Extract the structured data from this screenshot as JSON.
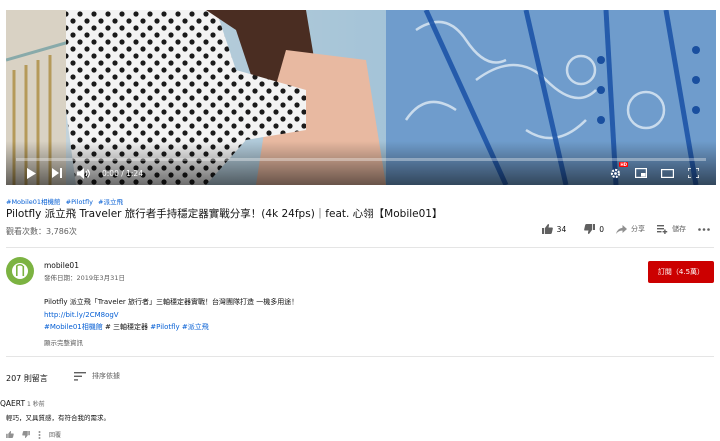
{
  "player": {
    "time": "0:00 / 1:24",
    "progress": 0.0,
    "icons": [
      "play-icon",
      "next-icon",
      "volume-icon",
      "settings-icon",
      "miniplayer-icon",
      "theater-icon",
      "fullscreen-icon"
    ],
    "accent": "#ff0000"
  },
  "video": {
    "hashtags": [
      "#Mobile01相機館",
      "#Pilotfly",
      "#派立飛"
    ],
    "title": "Pilotfly 派立飛 Traveler 旅行者手持穩定器實戰分享！(4k 24fps)｜feat. 心翎【Mobile01】",
    "views": "觀看次數：3,786次",
    "likes": "34",
    "dislikes": "0",
    "share_label": "分享",
    "save_label": "儲存"
  },
  "channel": {
    "name": "mobile01",
    "publish_date": "發佈日期：2019年3月31日",
    "subscribe_label": "訂閱（4.5萬）",
    "subscribe_color": "#cc0000",
    "avatar_color": "#7cb342"
  },
  "description": {
    "line1": "Pilotfly 派立飛「Traveler 旅行者」三軸穩定器實戰！台灣團隊打造 一機多用途！",
    "link": "http://bit.ly/2CM8ogV",
    "line3_tag1": "#Mobile01相機館",
    "line3_mid": " # 三軸穩定器 ",
    "line3_tag2": "#Pilotfly",
    "line3_tag3": "#派立飛",
    "show_more": "顯示完整資訊"
  },
  "comments": {
    "count": "207 則留言",
    "sort_label": "排序依據",
    "items": [
      {
        "author": "QAERT",
        "ago": "1 秒前",
        "text": "輕巧，又具質感，有符合我的需求。",
        "reply_label": "回覆"
      }
    ]
  }
}
